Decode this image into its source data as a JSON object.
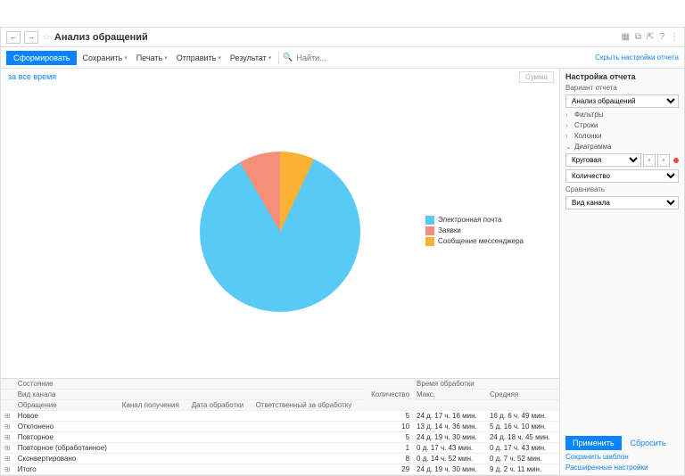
{
  "title": "Анализ обращений",
  "toolbar": {
    "generate": "Сформировать",
    "save": "Сохранить",
    "print": "Печать",
    "send": "Отправить",
    "result": "Результат",
    "search_placeholder": "Найти...",
    "hide_settings": "Скрыть настройки отчета"
  },
  "period": "за все время",
  "sum_placeholder": "Сумма",
  "chart_data": {
    "type": "pie",
    "title": "",
    "series": [
      {
        "name": "Электронная почта",
        "value": 85,
        "color": "#59caf5"
      },
      {
        "name": "Заявки",
        "value": 8,
        "color": "#f58f7a"
      },
      {
        "name": "Сообщение мессенджера",
        "value": 7,
        "color": "#f9b233"
      }
    ]
  },
  "table": {
    "headers": {
      "state": "Состояние",
      "channel_type": "Вид канала",
      "request": "Обращение",
      "channel": "Канал получения",
      "date": "Дата обработки",
      "responsible": "Ответственный за обработку",
      "count": "Количество",
      "proc_time": "Время обработки",
      "max": "Макс.",
      "avg": "Средняя"
    },
    "rows": [
      {
        "label": "Новое",
        "count": 5,
        "max": "24 д. 17 ч. 16 мин.",
        "avg": "16 д. 6 ч. 49 мин."
      },
      {
        "label": "Отклонено",
        "count": 10,
        "max": "13 д. 14 ч. 36 мин.",
        "avg": "5 д. 16 ч. 10 мин."
      },
      {
        "label": "Повторное",
        "count": 5,
        "max": "24 д. 19 ч. 30 мин.",
        "avg": "24 д. 18 ч. 45 мин."
      },
      {
        "label": "Повторное (обработанное)",
        "count": 1,
        "max": "0 д. 17 ч. 43 мин.",
        "avg": "0 д. 17 ч. 43 мин."
      },
      {
        "label": "Сконвертировано",
        "count": 8,
        "max": "0 д. 14 ч. 52 мин.",
        "avg": "0 д. 7 ч. 52 мин."
      },
      {
        "label": "Итого",
        "count": 29,
        "max": "24 д. 19 ч. 30 мин.",
        "avg": "9 д. 2 ч. 11 мин."
      }
    ]
  },
  "sidebar": {
    "title": "Настройка отчета",
    "variant_label": "Вариант отчета",
    "variant_value": "Анализ обращений",
    "filters": "Фильтры",
    "rows": "Строки",
    "columns": "Колонки",
    "diagram": "Диаграмма",
    "diagram_type": "Круговая",
    "measure": "Количество",
    "compare": "Сравнивать",
    "compare_value": "Вид канала",
    "apply": "Применить",
    "reset": "Сбросить",
    "save_template": "Сохранить шаблон",
    "advanced": "Расширенные настройки"
  }
}
